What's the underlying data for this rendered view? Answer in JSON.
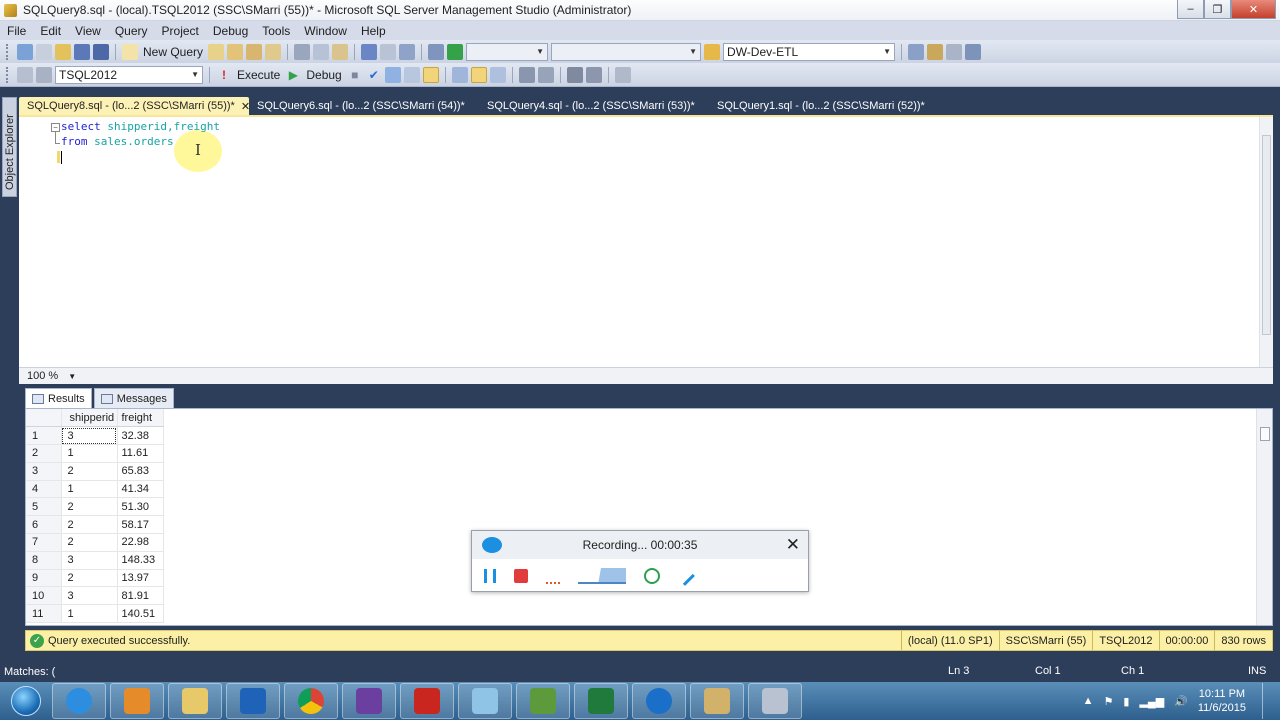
{
  "window": {
    "title": "SQLQuery8.sql - (local).TSQL2012 (SSC\\SMarri (55))* - Microsoft SQL Server Management Studio (Administrator)",
    "buttons": [
      "–",
      "❐",
      "✕"
    ]
  },
  "menu": [
    "File",
    "Edit",
    "View",
    "Query",
    "Project",
    "Debug",
    "Tools",
    "Window",
    "Help"
  ],
  "toolbar1": {
    "new_query": "New Query",
    "server_combo": "DW-Dev-ETL"
  },
  "toolbar2": {
    "database_combo": "TSQL2012",
    "execute": "Execute",
    "debug": "Debug"
  },
  "sidebar": {
    "object_explorer": "Object Explorer"
  },
  "doc_tabs": [
    "SQLQuery8.sql - (lo...2 (SSC\\SMarri (55))*",
    "SQLQuery6.sql - (lo...2 (SSC\\SMarri (54))*",
    "SQLQuery4.sql - (lo...2 (SSC\\SMarri (53))*",
    "SQLQuery1.sql - (lo...2 (SSC\\SMarri (52))*"
  ],
  "editor": {
    "line1_kw": "select",
    "line1_rest": " shipperid,freight",
    "line2_kw": "from",
    "line2_rest": " sales.orders"
  },
  "zoom": {
    "value": "100 %"
  },
  "results_tabs": [
    "Results",
    "Messages"
  ],
  "results": {
    "columns": [
      "shipperid",
      "freight"
    ],
    "rows": [
      [
        "1",
        "3",
        "32.38"
      ],
      [
        "2",
        "1",
        "11.61"
      ],
      [
        "3",
        "2",
        "65.83"
      ],
      [
        "4",
        "1",
        "41.34"
      ],
      [
        "5",
        "2",
        "51.30"
      ],
      [
        "6",
        "2",
        "58.17"
      ],
      [
        "7",
        "2",
        "22.98"
      ],
      [
        "8",
        "3",
        "148.33"
      ],
      [
        "9",
        "2",
        "13.97"
      ],
      [
        "10",
        "3",
        "81.91"
      ],
      [
        "11",
        "1",
        "140.51"
      ]
    ]
  },
  "recorder": {
    "status": "Recording... 00:00:35",
    "close": "✕"
  },
  "query_status": {
    "message": "Query executed successfully.",
    "server": "(local) (11.0 SP1)",
    "user": "SSC\\SMarri (55)",
    "database": "TSQL2012",
    "elapsed": "00:00:00",
    "rows": "830 rows"
  },
  "main_status": {
    "left": "Matches: (",
    "ln": "Ln 3",
    "col": "Col 1",
    "ch": "Ch 1",
    "mode": "INS"
  },
  "taskbar": {
    "time": "10:11 PM",
    "date": "11/6/2015",
    "apps": [
      "internet-explorer",
      "media-player",
      "file-explorer",
      "outlook",
      "chrome",
      "visual-studio",
      "acrobat",
      "app-generic",
      "project",
      "excel",
      "teamviewer",
      "tools",
      "calculator"
    ]
  }
}
